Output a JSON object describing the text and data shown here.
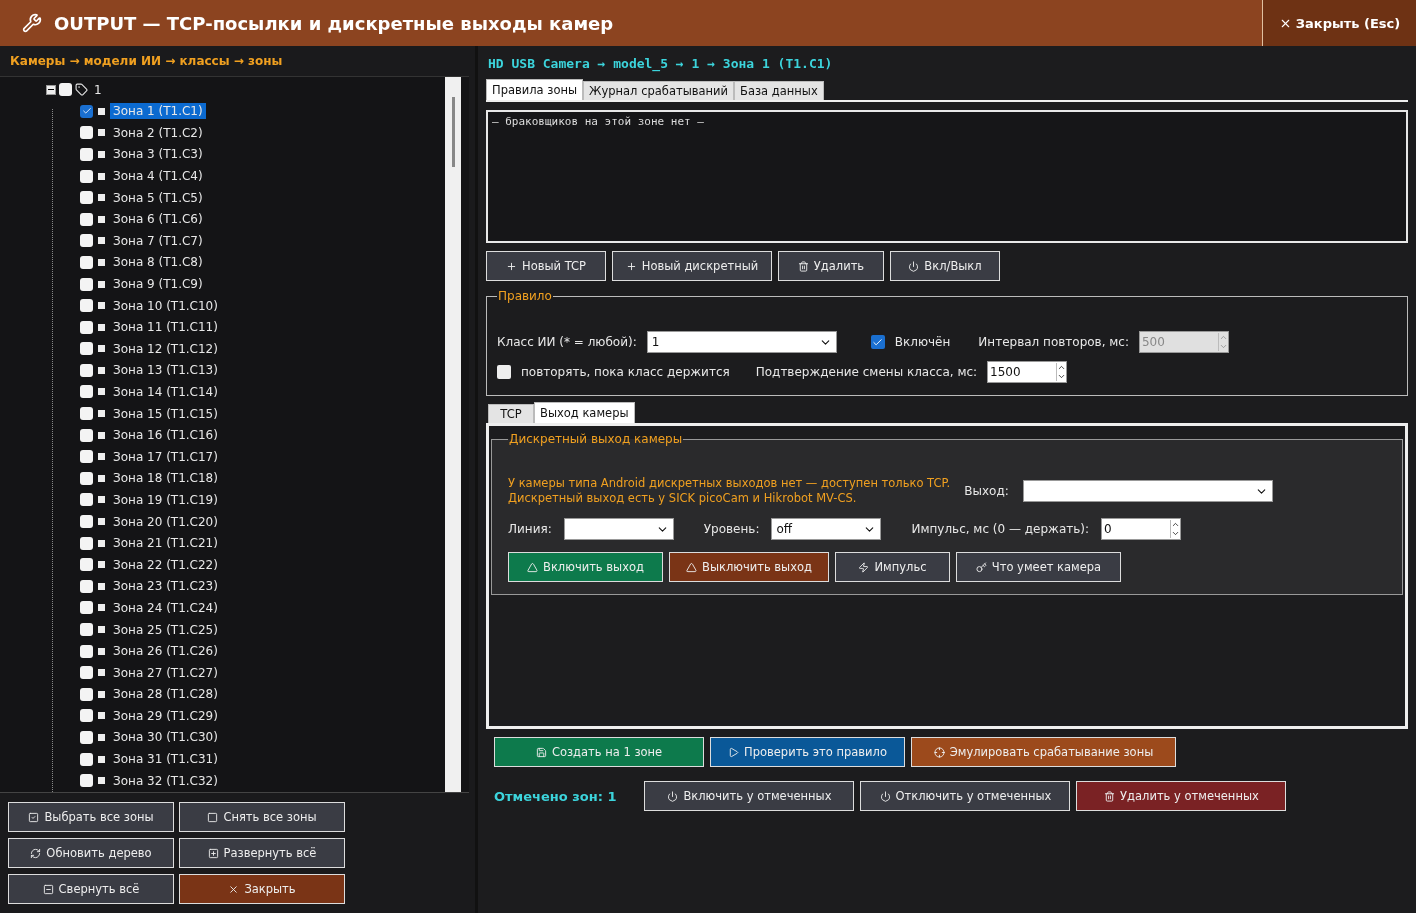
{
  "window": {
    "title": "OUTPUT — TCP-посылки и дискретные выходы камер",
    "close_button": "Закрыть (Esc)"
  },
  "tree": {
    "heading": "Камеры → модели ИИ → классы → зоны",
    "root": {
      "label": "1",
      "checked": false,
      "expanded": true,
      "children": [
        {
          "label": "Зона 1 (T1.C1)",
          "checked": true,
          "selected": true
        },
        {
          "label": "Зона 2 (T1.C2)",
          "checked": false,
          "selected": false
        },
        {
          "label": "Зона 3 (T1.C3)",
          "checked": false,
          "selected": false
        },
        {
          "label": "Зона 4 (T1.C4)",
          "checked": false,
          "selected": false
        },
        {
          "label": "Зона 5 (T1.C5)",
          "checked": false,
          "selected": false
        },
        {
          "label": "Зона 6 (T1.C6)",
          "checked": false,
          "selected": false
        },
        {
          "label": "Зона 7 (T1.C7)",
          "checked": false,
          "selected": false
        },
        {
          "label": "Зона 8 (T1.C8)",
          "checked": false,
          "selected": false
        },
        {
          "label": "Зона 9 (T1.C9)",
          "checked": false,
          "selected": false
        },
        {
          "label": "Зона 10 (T1.C10)",
          "checked": false,
          "selected": false
        },
        {
          "label": "Зона 11 (T1.C11)",
          "checked": false,
          "selected": false
        },
        {
          "label": "Зона 12 (T1.C12)",
          "checked": false,
          "selected": false
        },
        {
          "label": "Зона 13 (T1.C13)",
          "checked": false,
          "selected": false
        },
        {
          "label": "Зона 14 (T1.C14)",
          "checked": false,
          "selected": false
        },
        {
          "label": "Зона 15 (T1.C15)",
          "checked": false,
          "selected": false
        },
        {
          "label": "Зона 16 (T1.C16)",
          "checked": false,
          "selected": false
        },
        {
          "label": "Зона 17 (T1.C17)",
          "checked": false,
          "selected": false
        },
        {
          "label": "Зона 18 (T1.C18)",
          "checked": false,
          "selected": false
        },
        {
          "label": "Зона 19 (T1.C19)",
          "checked": false,
          "selected": false
        },
        {
          "label": "Зона 20 (T1.C20)",
          "checked": false,
          "selected": false
        },
        {
          "label": "Зона 21 (T1.C21)",
          "checked": false,
          "selected": false
        },
        {
          "label": "Зона 22 (T1.C22)",
          "checked": false,
          "selected": false
        },
        {
          "label": "Зона 23 (T1.C23)",
          "checked": false,
          "selected": false
        },
        {
          "label": "Зона 24 (T1.C24)",
          "checked": false,
          "selected": false
        },
        {
          "label": "Зона 25 (T1.C25)",
          "checked": false,
          "selected": false
        },
        {
          "label": "Зона 26 (T1.C26)",
          "checked": false,
          "selected": false
        },
        {
          "label": "Зона 27 (T1.C27)",
          "checked": false,
          "selected": false
        },
        {
          "label": "Зона 28 (T1.C28)",
          "checked": false,
          "selected": false
        },
        {
          "label": "Зона 29 (T1.C29)",
          "checked": false,
          "selected": false
        },
        {
          "label": "Зона 30 (T1.C30)",
          "checked": false,
          "selected": false
        },
        {
          "label": "Зона 31 (T1.C31)",
          "checked": false,
          "selected": false
        },
        {
          "label": "Зона 32 (T1.C32)",
          "checked": false,
          "selected": false
        }
      ]
    }
  },
  "tree_buttons": [
    {
      "label": "Выбрать все зоны",
      "kind": "default"
    },
    {
      "label": "Снять все зоны",
      "kind": "default"
    },
    {
      "label": "Обновить дерево",
      "kind": "default"
    },
    {
      "label": "Развернуть всё",
      "kind": "default"
    },
    {
      "label": "Свернуть всё",
      "kind": "default"
    },
    {
      "label": "Закрыть",
      "kind": "brown"
    }
  ],
  "breadcrumb": "HD USB Camera → model_5 → 1 → Зона 1 (T1.C1)",
  "tabs": [
    {
      "label": "Правила зоны",
      "selected": true
    },
    {
      "label": "Журнал срабатываний",
      "selected": false
    },
    {
      "label": "База данных",
      "selected": false
    }
  ],
  "rules_list": {
    "empty_text": "— браковщиков на этой зоне нет —"
  },
  "rule_buttons": [
    {
      "label": "Новый TCP",
      "kind": "default"
    },
    {
      "label": "Новый дискретный",
      "kind": "default"
    },
    {
      "label": "Удалить",
      "kind": "default"
    },
    {
      "label": "Вкл/Выкл",
      "kind": "default"
    }
  ],
  "rule": {
    "title": "Правило",
    "class_field": {
      "label": "Класс ИИ (* = любой):",
      "value": "1"
    },
    "enabled": {
      "label": "Включён",
      "checked": true
    },
    "repeat_interval": {
      "label": "Интервал повторов, мс:",
      "value": "500",
      "disabled": true
    },
    "repeat_while": {
      "label": "повторять, пока класс держится",
      "checked": false
    },
    "confirm": {
      "label": "Подтверждение смены класса, мс:",
      "value": "1500",
      "disabled": false
    }
  },
  "rule_tabs": [
    {
      "label": "TCP",
      "selected": false
    },
    {
      "label": "Выход камеры",
      "selected": true
    }
  ],
  "discrete": {
    "title": "Дискретный выход камеры",
    "note": [
      "У камеры типа Android дискретных выходов нет — доступен только TCP.",
      "Дискретный выход есть у SICK picoCam и Hikrobot MV-CS."
    ],
    "output": {
      "label": "Выход:"
    },
    "line": {
      "label": "Линия:"
    },
    "level": {
      "label": "Уровень:",
      "value": "off"
    },
    "pulse": {
      "label": "Импульс, мс (0 — держать):",
      "value": "0"
    },
    "buttons": [
      {
        "label": "Включить выход",
        "kind": "green"
      },
      {
        "label": "Выключить выход",
        "kind": "brown"
      },
      {
        "label": "Импульс",
        "kind": "default"
      },
      {
        "label": "Что умеет камера",
        "kind": "default"
      }
    ]
  },
  "actions": [
    {
      "label": "Создать на 1 зоне",
      "kind": "green"
    },
    {
      "label": "Проверить это правило",
      "kind": "blue"
    },
    {
      "label": "Эмулировать срабатывание зоны",
      "kind": "orange"
    }
  ],
  "marked_count": "Отмечено зон: 1",
  "bulk_buttons": [
    {
      "label": "Включить у отмеченных",
      "kind": "default"
    },
    {
      "label": "Отключить у отмеченных",
      "kind": "default"
    },
    {
      "label": "Удалить у отмеченных",
      "kind": "red"
    }
  ]
}
